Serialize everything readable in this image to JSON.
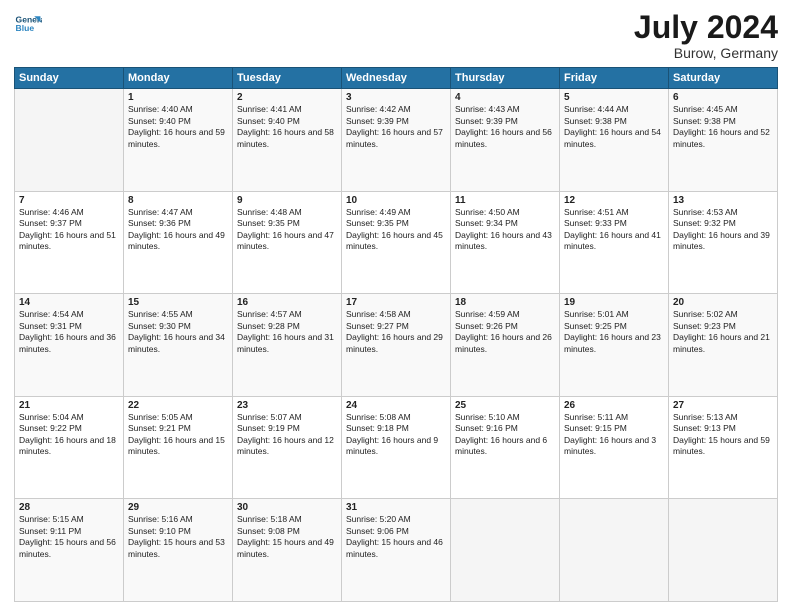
{
  "logo": {
    "line1": "General",
    "line2": "Blue"
  },
  "title": "July 2024",
  "subtitle": "Burow, Germany",
  "header_days": [
    "Sunday",
    "Monday",
    "Tuesday",
    "Wednesday",
    "Thursday",
    "Friday",
    "Saturday"
  ],
  "weeks": [
    [
      {
        "day": "",
        "empty": true
      },
      {
        "day": "1",
        "sunrise": "4:40 AM",
        "sunset": "9:40 PM",
        "daylight": "16 hours and 59 minutes."
      },
      {
        "day": "2",
        "sunrise": "4:41 AM",
        "sunset": "9:40 PM",
        "daylight": "16 hours and 58 minutes."
      },
      {
        "day": "3",
        "sunrise": "4:42 AM",
        "sunset": "9:39 PM",
        "daylight": "16 hours and 57 minutes."
      },
      {
        "day": "4",
        "sunrise": "4:43 AM",
        "sunset": "9:39 PM",
        "daylight": "16 hours and 56 minutes."
      },
      {
        "day": "5",
        "sunrise": "4:44 AM",
        "sunset": "9:38 PM",
        "daylight": "16 hours and 54 minutes."
      },
      {
        "day": "6",
        "sunrise": "4:45 AM",
        "sunset": "9:38 PM",
        "daylight": "16 hours and 52 minutes."
      }
    ],
    [
      {
        "day": "7",
        "sunrise": "4:46 AM",
        "sunset": "9:37 PM",
        "daylight": "16 hours and 51 minutes."
      },
      {
        "day": "8",
        "sunrise": "4:47 AM",
        "sunset": "9:36 PM",
        "daylight": "16 hours and 49 minutes."
      },
      {
        "day": "9",
        "sunrise": "4:48 AM",
        "sunset": "9:35 PM",
        "daylight": "16 hours and 47 minutes."
      },
      {
        "day": "10",
        "sunrise": "4:49 AM",
        "sunset": "9:35 PM",
        "daylight": "16 hours and 45 minutes."
      },
      {
        "day": "11",
        "sunrise": "4:50 AM",
        "sunset": "9:34 PM",
        "daylight": "16 hours and 43 minutes."
      },
      {
        "day": "12",
        "sunrise": "4:51 AM",
        "sunset": "9:33 PM",
        "daylight": "16 hours and 41 minutes."
      },
      {
        "day": "13",
        "sunrise": "4:53 AM",
        "sunset": "9:32 PM",
        "daylight": "16 hours and 39 minutes."
      }
    ],
    [
      {
        "day": "14",
        "sunrise": "4:54 AM",
        "sunset": "9:31 PM",
        "daylight": "16 hours and 36 minutes."
      },
      {
        "day": "15",
        "sunrise": "4:55 AM",
        "sunset": "9:30 PM",
        "daylight": "16 hours and 34 minutes."
      },
      {
        "day": "16",
        "sunrise": "4:57 AM",
        "sunset": "9:28 PM",
        "daylight": "16 hours and 31 minutes."
      },
      {
        "day": "17",
        "sunrise": "4:58 AM",
        "sunset": "9:27 PM",
        "daylight": "16 hours and 29 minutes."
      },
      {
        "day": "18",
        "sunrise": "4:59 AM",
        "sunset": "9:26 PM",
        "daylight": "16 hours and 26 minutes."
      },
      {
        "day": "19",
        "sunrise": "5:01 AM",
        "sunset": "9:25 PM",
        "daylight": "16 hours and 23 minutes."
      },
      {
        "day": "20",
        "sunrise": "5:02 AM",
        "sunset": "9:23 PM",
        "daylight": "16 hours and 21 minutes."
      }
    ],
    [
      {
        "day": "21",
        "sunrise": "5:04 AM",
        "sunset": "9:22 PM",
        "daylight": "16 hours and 18 minutes."
      },
      {
        "day": "22",
        "sunrise": "5:05 AM",
        "sunset": "9:21 PM",
        "daylight": "16 hours and 15 minutes."
      },
      {
        "day": "23",
        "sunrise": "5:07 AM",
        "sunset": "9:19 PM",
        "daylight": "16 hours and 12 minutes."
      },
      {
        "day": "24",
        "sunrise": "5:08 AM",
        "sunset": "9:18 PM",
        "daylight": "16 hours and 9 minutes."
      },
      {
        "day": "25",
        "sunrise": "5:10 AM",
        "sunset": "9:16 PM",
        "daylight": "16 hours and 6 minutes."
      },
      {
        "day": "26",
        "sunrise": "5:11 AM",
        "sunset": "9:15 PM",
        "daylight": "16 hours and 3 minutes."
      },
      {
        "day": "27",
        "sunrise": "5:13 AM",
        "sunset": "9:13 PM",
        "daylight": "15 hours and 59 minutes."
      }
    ],
    [
      {
        "day": "28",
        "sunrise": "5:15 AM",
        "sunset": "9:11 PM",
        "daylight": "15 hours and 56 minutes."
      },
      {
        "day": "29",
        "sunrise": "5:16 AM",
        "sunset": "9:10 PM",
        "daylight": "15 hours and 53 minutes."
      },
      {
        "day": "30",
        "sunrise": "5:18 AM",
        "sunset": "9:08 PM",
        "daylight": "15 hours and 49 minutes."
      },
      {
        "day": "31",
        "sunrise": "5:20 AM",
        "sunset": "9:06 PM",
        "daylight": "15 hours and 46 minutes."
      },
      {
        "day": "",
        "empty": true
      },
      {
        "day": "",
        "empty": true
      },
      {
        "day": "",
        "empty": true
      }
    ]
  ],
  "labels": {
    "sunrise_prefix": "Sunrise: ",
    "sunset_prefix": "Sunset: ",
    "daylight_prefix": "Daylight: "
  }
}
